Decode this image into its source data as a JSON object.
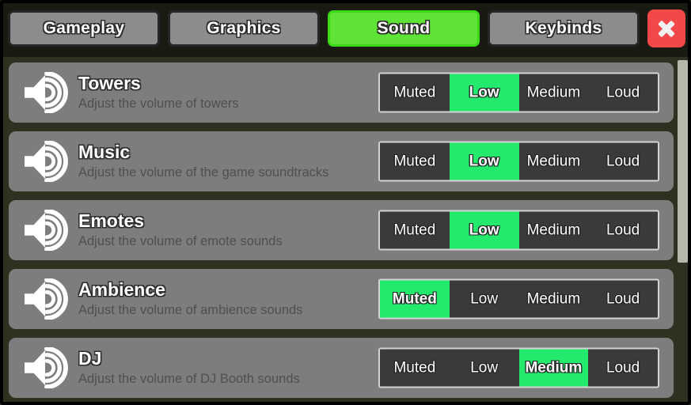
{
  "window": {
    "accent_green": "#23e96c",
    "tab_active_green": "#5fe336",
    "close_red": "#f2484a",
    "row_gray": "#7d7d7d",
    "background": "#2e3020"
  },
  "tabs": [
    {
      "label": "Gameplay",
      "active": false
    },
    {
      "label": "Graphics",
      "active": false
    },
    {
      "label": "Sound",
      "active": true
    },
    {
      "label": "Keybinds",
      "active": false
    }
  ],
  "close_button": {
    "icon": "close-icon",
    "label": "X"
  },
  "volume_options": [
    "Muted",
    "Low",
    "Medium",
    "Loud"
  ],
  "settings": [
    {
      "icon": "speaker-icon",
      "title": "Towers",
      "description": "Adjust the volume of towers",
      "selected": "Low",
      "options": [
        "Muted",
        "Low",
        "Medium",
        "Loud"
      ]
    },
    {
      "icon": "speaker-icon",
      "title": "Music",
      "description": "Adjust the volume of the game soundtracks",
      "selected": "Low",
      "options": [
        "Muted",
        "Low",
        "Medium",
        "Loud"
      ]
    },
    {
      "icon": "speaker-icon",
      "title": "Emotes",
      "description": "Adjust the volume of emote sounds",
      "selected": "Low",
      "options": [
        "Muted",
        "Low",
        "Medium",
        "Loud"
      ]
    },
    {
      "icon": "speaker-icon",
      "title": "Ambience",
      "description": "Adjust the volume of ambience sounds",
      "selected": "Muted",
      "options": [
        "Muted",
        "Low",
        "Medium",
        "Loud"
      ]
    },
    {
      "icon": "speaker-icon",
      "title": "DJ",
      "description": "Adjust the volume of DJ Booth sounds",
      "selected": "Medium",
      "options": [
        "Muted",
        "Low",
        "Medium",
        "Loud"
      ]
    }
  ],
  "scrollbar": {
    "name": "vertical-scrollbar"
  }
}
